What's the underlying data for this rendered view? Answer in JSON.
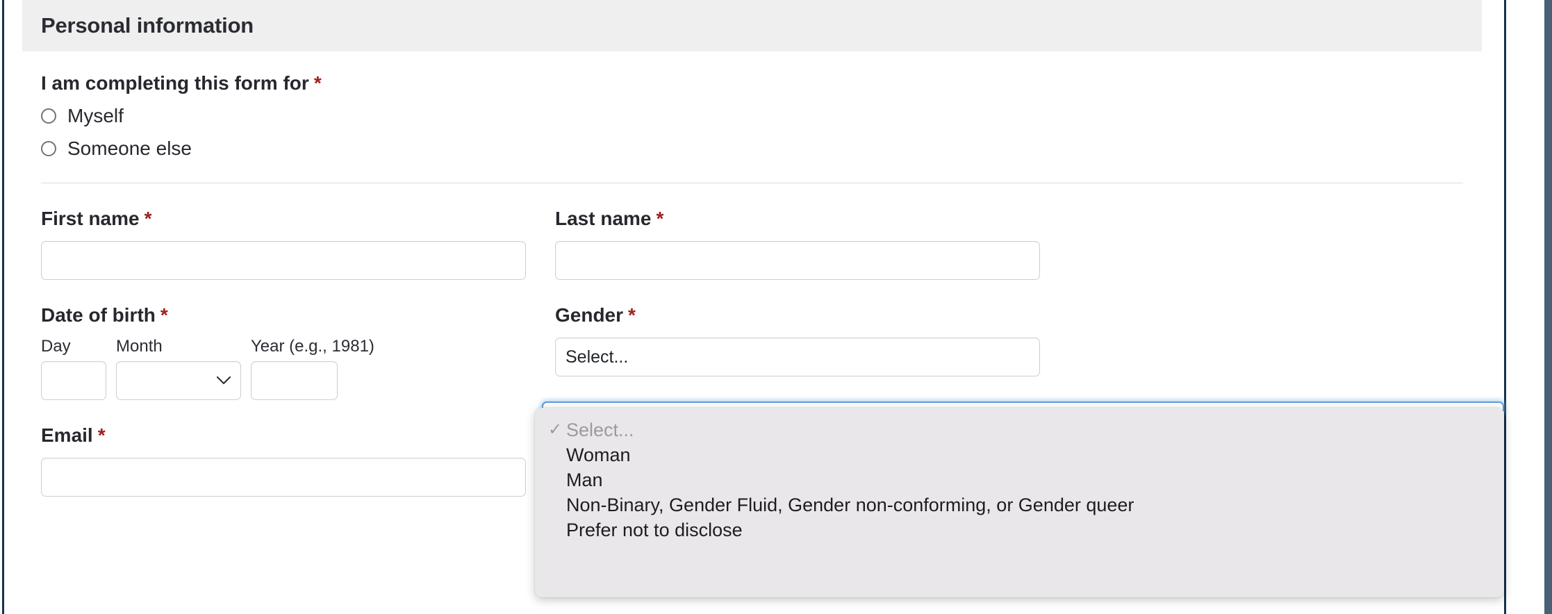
{
  "card": {
    "header_title": "Personal information"
  },
  "form": {
    "completing_for": {
      "label": "I am completing this form for",
      "required_marker": "*",
      "options": [
        {
          "label": "Myself",
          "selected": false
        },
        {
          "label": "Someone else",
          "selected": false
        }
      ]
    },
    "first_name": {
      "label": "First name",
      "required_marker": "*",
      "value": "",
      "placeholder": ""
    },
    "last_name": {
      "label": "Last name",
      "required_marker": "*",
      "value": "",
      "placeholder": ""
    },
    "date_of_birth": {
      "label": "Date of birth",
      "required_marker": "*",
      "day": {
        "label": "Day",
        "value": "",
        "placeholder": ""
      },
      "month": {
        "label": "Month",
        "value": "",
        "selected_option": ""
      },
      "year": {
        "label": "Year (e.g., 1981)",
        "value": "",
        "placeholder": ""
      }
    },
    "gender": {
      "label": "Gender",
      "required_marker": "*",
      "selected_value": "Select...",
      "expanded": true,
      "options": [
        {
          "label": "Select...",
          "checked": true,
          "placeholder": true
        },
        {
          "label": "Woman",
          "checked": false,
          "placeholder": false
        },
        {
          "label": "Man",
          "checked": false,
          "placeholder": false
        },
        {
          "label": "Non-Binary, Gender Fluid, Gender non-conforming, or Gender queer",
          "checked": false,
          "placeholder": false
        },
        {
          "label": "Prefer not to disclose",
          "checked": false,
          "placeholder": false
        }
      ],
      "check_glyph": "✓"
    },
    "email": {
      "label": "Email",
      "required_marker": "*",
      "value": "",
      "placeholder": ""
    }
  },
  "icons": {
    "chevron_down": "chevron-down-icon",
    "radio_unchecked": "radio-unchecked-icon",
    "check": "check-icon"
  },
  "colors": {
    "header_bg": "#efefef",
    "required_asterisk": "#a02020",
    "page_border": "#16314f",
    "right_rail": "#4c6075",
    "dropdown_bg": "#eae7ea",
    "focus_ring": "#5b9dd9",
    "input_border": "#cfcfcf",
    "text": "#26282d"
  }
}
